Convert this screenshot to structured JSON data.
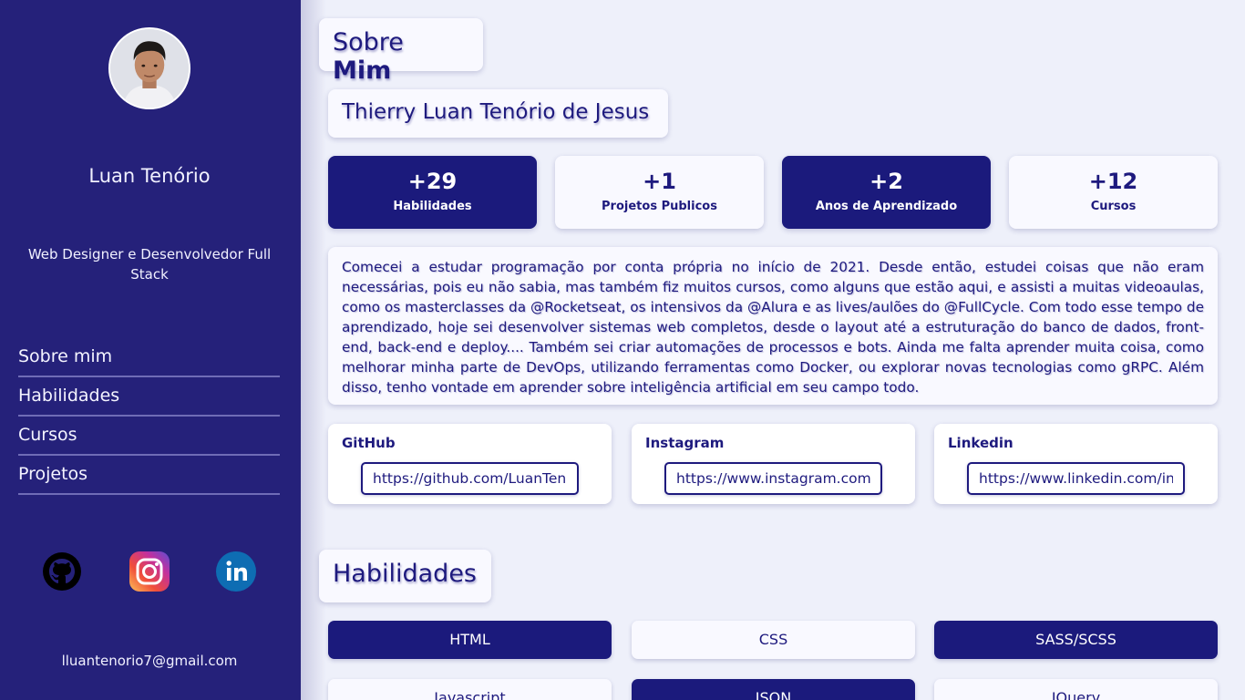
{
  "sidebar": {
    "name": "Luan Tenório",
    "role": "Web Designer e Desenvolvedor Full Stack",
    "nav": [
      {
        "label": "Sobre mim"
      },
      {
        "label": "Habilidades"
      },
      {
        "label": "Cursos"
      },
      {
        "label": "Projetos"
      }
    ],
    "socials": [
      {
        "icon": "github-icon"
      },
      {
        "icon": "instagram-icon"
      },
      {
        "icon": "linkedin-icon"
      }
    ],
    "email": "lluantenorio7@gmail.com"
  },
  "about": {
    "title_prefix": "Sobre",
    "title_bold": "Mim",
    "full_name": "Thierry Luan Tenório de Jesus",
    "stats": [
      {
        "value": "+29",
        "label": "Habilidades"
      },
      {
        "value": "+1",
        "label": "Projetos Publicos"
      },
      {
        "value": "+2",
        "label": "Anos de Aprendizado"
      },
      {
        "value": "+12",
        "label": "Cursos"
      }
    ],
    "bio": "Comecei a estudar programação por conta própria no início de 2021. Desde então, estudei coisas que não eram necessárias, pois eu não sabia, mas também fiz muitos cursos, como alguns que estão aqui, e assisti a muitas videoaulas, como os masterclasses da @Rocketseat, os intensivos da @Alura e as lives/aulões do @FullCycle. Com todo esse tempo de aprendizado, hoje sei desenvolver sistemas web completos, desde o layout até a estruturação do banco de dados, front-end, back-end e deploy.... Também sei criar automações de processos e bots. Ainda me falta aprender muita coisa, como melhorar minha parte de DevOps, utilizando ferramentas como Docker, ou explorar novas tecnologias como gRPC. Além disso, tenho vontade em aprender sobre inteligência artificial em seu campo todo.",
    "links": [
      {
        "label": "GitHub",
        "value": "https://github.com/LuanTenorio"
      },
      {
        "label": "Instagram",
        "value": "https://www.instagram.com/luantenorio"
      },
      {
        "label": "Linkedin",
        "value": "https://www.linkedin.com/in/luantenorio"
      }
    ]
  },
  "skills": {
    "title": "Habilidades",
    "items": [
      {
        "label": "HTML"
      },
      {
        "label": "CSS"
      },
      {
        "label": "SASS/SCSS"
      },
      {
        "label": "Javascript"
      },
      {
        "label": "JSON"
      },
      {
        "label": "JQuery"
      }
    ]
  },
  "colors": {
    "sidebar_bg": "#25217a",
    "accent": "#1b1a7c",
    "page_bg": "#eef0fa",
    "card_bg": "#f9f9ff"
  }
}
